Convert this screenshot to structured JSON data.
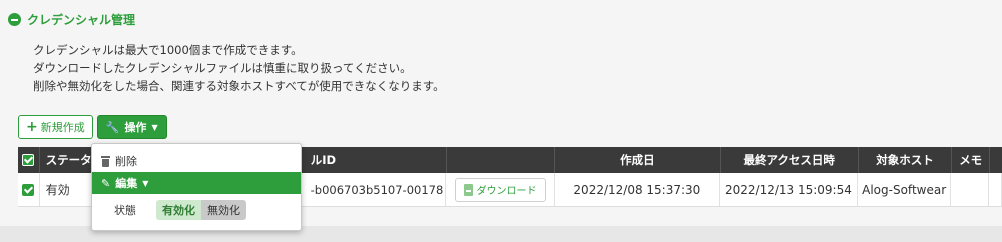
{
  "section": {
    "title": "クレデンシャル管理"
  },
  "description": [
    "クレデンシャルは最大で1000個まで作成できます。",
    "ダウンロードしたクレデンシャルファイルは慎重に取り扱ってください。",
    "削除や無効化をした場合、関連する対象ホストすべてが使用できなくなります。"
  ],
  "toolbar": {
    "new_label": "新規作成",
    "ops_label": "操作"
  },
  "table": {
    "headers": {
      "status": "ステータ",
      "id": "ルID",
      "created": "作成日",
      "last_access": "最終アクセス日時",
      "host": "対象ホスト",
      "memo": "メモ"
    },
    "rows": [
      {
        "status": "有効",
        "id": "-b006703b5107-00178",
        "download_label": "ダウンロード",
        "created": "2022/12/08 15:37:30",
        "last_access": "2022/12/13 15:09:54",
        "host": "Alog-Softwear",
        "memo": ""
      }
    ]
  },
  "dropdown": {
    "delete_label": "削除",
    "edit_label": "編集",
    "status_label": "状態",
    "toggle_on": "有効化",
    "toggle_off": "無効化"
  },
  "colors": {
    "accent": "#2e9e3c",
    "header_bg": "#3a3a3a"
  }
}
